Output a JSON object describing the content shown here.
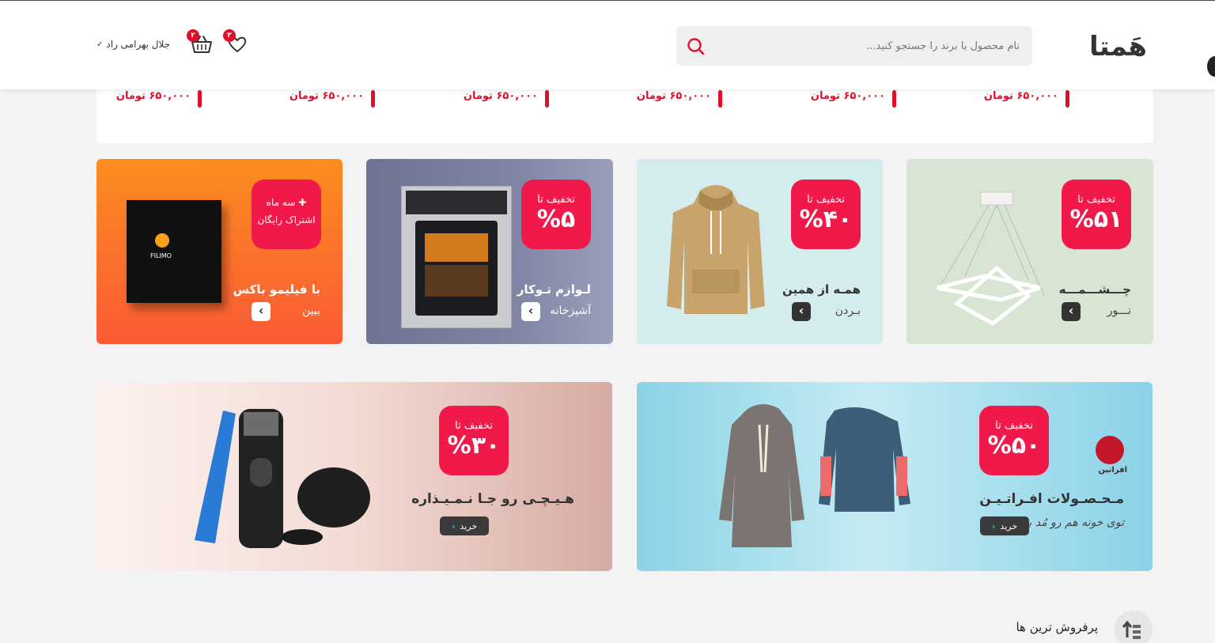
{
  "header": {
    "logo": "هَمتا",
    "search_placeholder": "نام محصول یا برند را جستجو کنید...",
    "user_name": "جلال بهرامی راد",
    "cart_count": "۲",
    "favorites_count": "۳"
  },
  "price_strip": {
    "prices": [
      "۶۵۰,۰۰۰ تومان",
      "۶۵۰,۰۰۰ تومان",
      "۶۵۰,۰۰۰ تومان",
      "۶۵۰,۰۰۰ تومان",
      "۶۵۰,۰۰۰ تومان",
      "۶۵۰,۰۰۰ تومان"
    ]
  },
  "promo_cards": [
    {
      "discount_label": "تخفیف تا",
      "discount_value": "%۵۱",
      "title": "چـــشـــمـــه",
      "subtitle": "نـــور"
    },
    {
      "discount_label": "تخفیف تا",
      "discount_value": "%۴۰",
      "title": "همـه از همین",
      "subtitle": "بـردن"
    },
    {
      "discount_label": "تخفیف تا",
      "discount_value": "%۵",
      "title": "لـوازم تـوکار",
      "subtitle": "آشپزخانه"
    },
    {
      "discount_label": "سه ماه",
      "discount_value": "اشتراک رایگان",
      "title": "با فیلیمو باکس",
      "subtitle": "ببین",
      "box_brand": "FILIMO"
    }
  ],
  "wide_banners": [
    {
      "discount_label": "تخفیف تا",
      "discount_value": "%۵۰",
      "title": "مـحـصـولات افـراتـیـن",
      "subtitle": "توی خونه هم رو مُد بپوش",
      "button": "خرید",
      "logo_text": "افراتین"
    },
    {
      "discount_label": "تخفیف تا",
      "discount_value": "%۳۰",
      "title": "هـیـچـی رو جـا نـمـیـذاره",
      "button": "خرید"
    }
  ],
  "section": {
    "title": "پرفروش ترین ها"
  },
  "colors": {
    "accent": "#f0194a",
    "price_red": "#e0102a"
  }
}
